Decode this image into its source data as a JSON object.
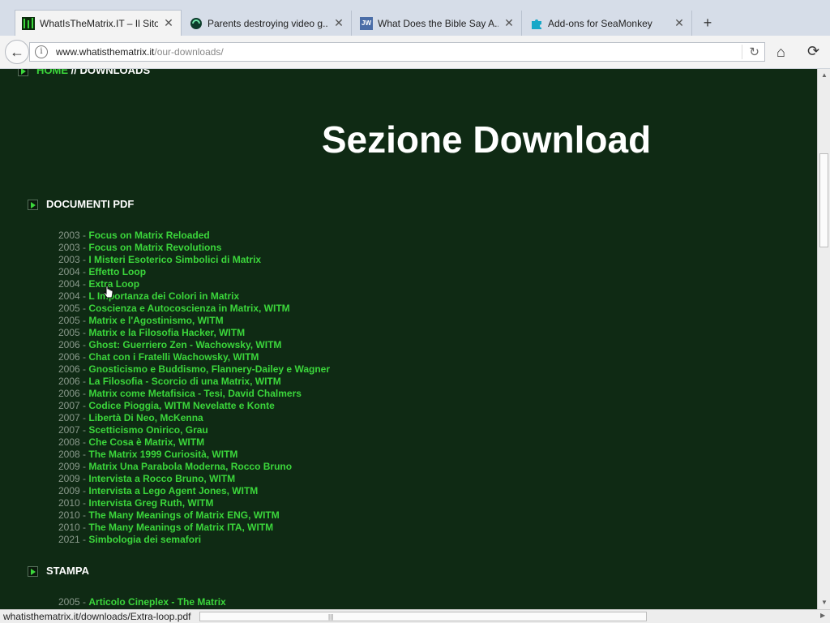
{
  "tabs": [
    {
      "title": "WhatIsTheMatrix.IT – Il Sito...",
      "icon": "matrix-favicon-icon",
      "active": true
    },
    {
      "title": "Parents destroying video g...",
      "icon": "gaming-favicon-icon",
      "active": false
    },
    {
      "title": "What Does the Bible Say A...",
      "icon": "jw-favicon-icon",
      "icon_text": "JW",
      "active": false
    },
    {
      "title": "Add-ons for SeaMonkey",
      "icon": "puzzle-favicon-icon",
      "active": false
    }
  ],
  "url": {
    "host": "www.whatisthematrix.it",
    "path": "/our-downloads/"
  },
  "breadcrumb": {
    "home": "Home",
    "separator": " // ",
    "current": "Downloads"
  },
  "page_title": "Sezione Download",
  "sections": [
    {
      "heading": "Documenti PDF",
      "items": [
        {
          "year": "2003",
          "title": "Focus on Matrix Reloaded"
        },
        {
          "year": "2003",
          "title": "Focus on Matrix Revolutions"
        },
        {
          "year": "2003",
          "title": "I Misteri Esoterico Simbolici di Matrix"
        },
        {
          "year": "2004",
          "title": "Effetto Loop"
        },
        {
          "year": "2004",
          "title": "Extra Loop"
        },
        {
          "year": "2004",
          "title": "L Importanza dei Colori in Matrix"
        },
        {
          "year": "2005",
          "title": "Coscienza e Autocoscienza in Matrix, WITM"
        },
        {
          "year": "2005",
          "title": "Matrix e l'Agostinismo, WITM"
        },
        {
          "year": "2005",
          "title": "Matrix e la Filosofia Hacker, WITM"
        },
        {
          "year": "2006",
          "title": "Ghost: Guerriero Zen - Wachowsky, WITM"
        },
        {
          "year": "2006",
          "title": "Chat con i Fratelli Wachowsky, WITM"
        },
        {
          "year": "2006",
          "title": "Gnosticismo e Buddismo, Flannery-Dailey e Wagner"
        },
        {
          "year": "2006",
          "title": "La Filosofia - Scorcio di una Matrix, WITM"
        },
        {
          "year": "2006",
          "title": "Matrix come Metafisica - Tesi, David Chalmers"
        },
        {
          "year": "2007",
          "title": "Codice Pioggia, WITM Nevelatte e Konte"
        },
        {
          "year": "2007",
          "title": "Libertà Di Neo, McKenna"
        },
        {
          "year": "2007",
          "title": "Scetticismo Onirico, Grau"
        },
        {
          "year": "2008",
          "title": "Che Cosa è Matrix, WITM"
        },
        {
          "year": "2008",
          "title": "The Matrix 1999 Curiosità, WITM"
        },
        {
          "year": "2009",
          "title": "Matrix Una Parabola Moderna, Rocco Bruno"
        },
        {
          "year": "2009",
          "title": "Intervista a Rocco Bruno, WITM"
        },
        {
          "year": "2009",
          "title": "Intervista a Lego Agent Jones, WITM"
        },
        {
          "year": "2010",
          "title": "Intervista Greg Ruth, WITM"
        },
        {
          "year": "2010",
          "title": "The Many Meanings of Matrix ENG, WITM"
        },
        {
          "year": "2010",
          "title": "The Many Meanings of Matrix ITA, WITM"
        },
        {
          "year": "2021",
          "title": "Simbologia dei semafori"
        }
      ]
    },
    {
      "heading": "Stampa",
      "items": [
        {
          "year": "2005",
          "title": "Articolo Cineplex - The Matrix"
        }
      ]
    }
  ],
  "status_text": "whatisthematrix.it/downloads/Extra-loop.pdf",
  "colors": {
    "page_bg": "#0f2a14",
    "link": "#3bd63b",
    "year": "#8a9a8c",
    "heading": "#ffffff"
  }
}
